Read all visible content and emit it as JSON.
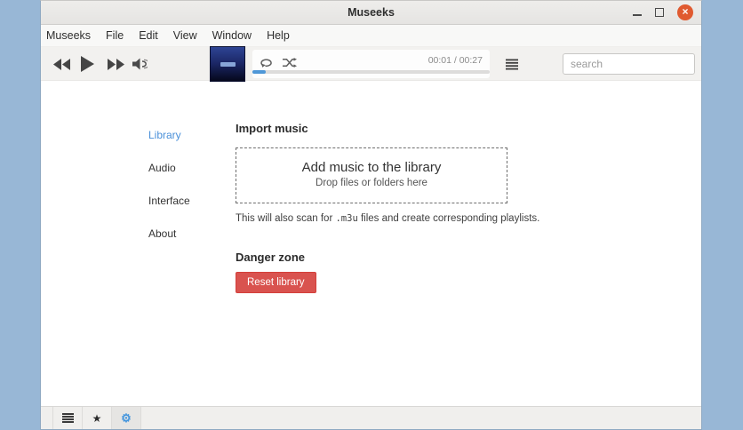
{
  "colors": {
    "desktop_background": "#98b7d6",
    "accent_blue": "#4a90d9",
    "danger_red": "#d9534f",
    "close_button_orange": "#e05a30"
  },
  "titlebar": {
    "title": "Museeks",
    "close_glyph": "×"
  },
  "menubar": {
    "items": [
      "Museeks",
      "File",
      "Edit",
      "View",
      "Window",
      "Help"
    ]
  },
  "player": {
    "elapsed": "00:01",
    "duration": "00:27",
    "time_display": "00:01 / 00:27",
    "progress_percent": 5.5,
    "progress_style": "width:5.5%",
    "search_placeholder": "search",
    "icons": {
      "previous": "previous-track-icon",
      "play": "play-icon",
      "next": "next-track-icon",
      "volume": "volume-icon",
      "repeat": "repeat-icon",
      "shuffle": "shuffle-icon",
      "queue": "queue-list-icon"
    }
  },
  "settings": {
    "nav": {
      "active": "Library",
      "items": [
        "Library",
        "Audio",
        "Interface",
        "About"
      ]
    },
    "import_section": {
      "heading": "Import music",
      "dropzone_title": "Add music to the library",
      "dropzone_subtitle": "Drop files or folders here",
      "note_prefix": "This will also scan for ",
      "note_code": ".m3u",
      "note_suffix": " files and create corresponding playlists."
    },
    "danger_section": {
      "heading": "Danger zone",
      "reset_button_label": "Reset library"
    }
  },
  "footer": {
    "active": "settings",
    "star_glyph": "★",
    "gear_glyph": "⚙"
  }
}
